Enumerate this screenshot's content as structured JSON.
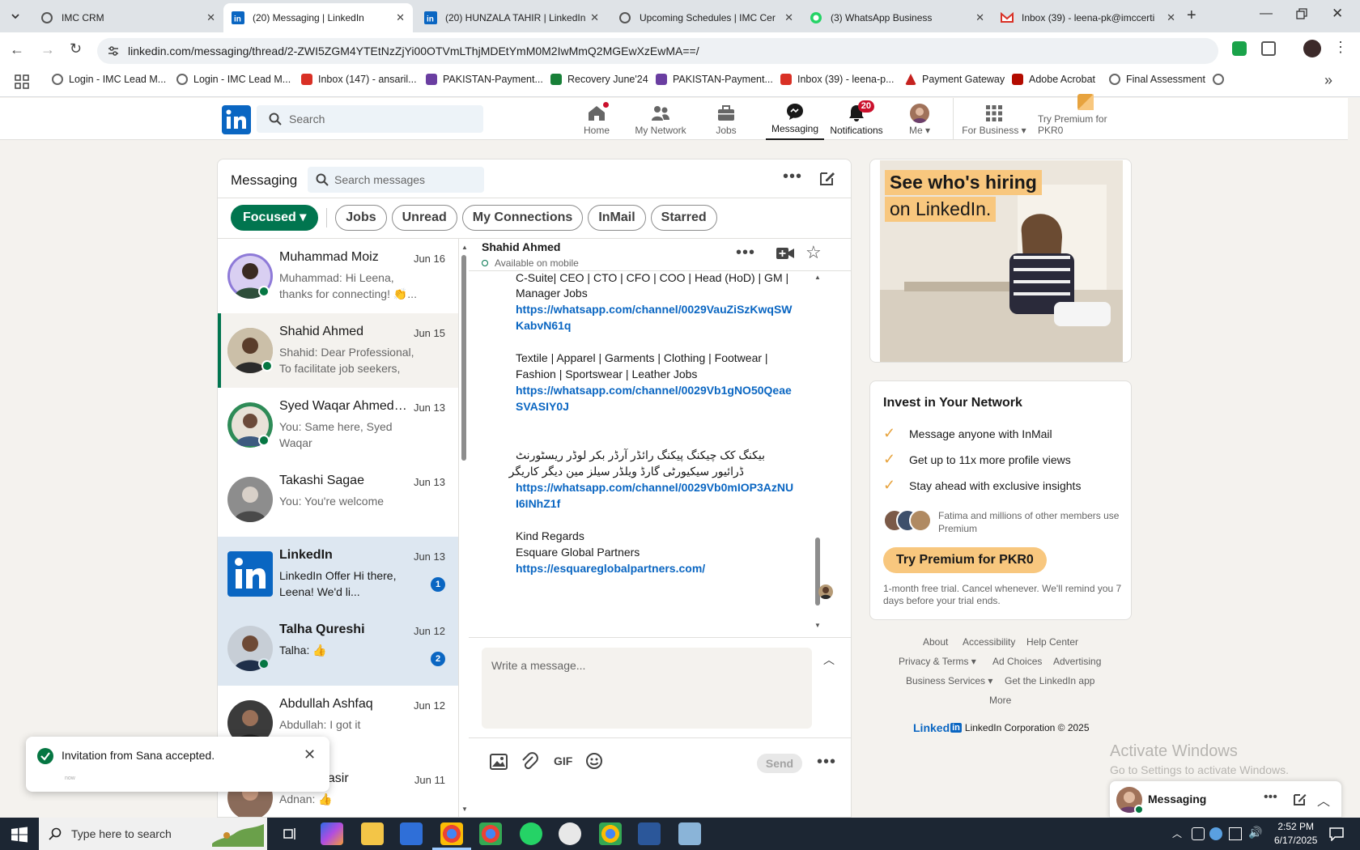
{
  "tabs": [
    {
      "title": "IMC CRM",
      "active": false
    },
    {
      "title": "(20) Messaging | LinkedIn",
      "active": true
    },
    {
      "title": "(20) HUNZALA TAHIR | LinkedIn",
      "active": false
    },
    {
      "title": "Upcoming Schedules | IMC Cer",
      "active": false
    },
    {
      "title": "(3) WhatsApp Business",
      "active": false
    },
    {
      "title": "Inbox (39) - leena-pk@imccerti",
      "active": false
    }
  ],
  "url": "linkedin.com/messaging/thread/2-ZWI5ZGM4YTEtNzZjYi00OTVmLThjMDEtYmM0M2IwMmQ2MGEwXzEwMA==/",
  "bookmarks": [
    "Login - IMC Lead M...",
    "Login - IMC Lead M...",
    "Inbox (147) - ansaril...",
    "PAKISTAN-Payment...",
    "Recovery June'24",
    "PAKISTAN-Payment...",
    "Inbox (39) - leena-p...",
    "Payment Gateway",
    "Adobe Acrobat",
    "Final Assessment"
  ],
  "nav": {
    "search_placeholder": "Search",
    "home": "Home",
    "network": "My Network",
    "jobs": "Jobs",
    "messaging": "Messaging",
    "notifications": "Notifications",
    "notifications_badge": "20",
    "me": "Me",
    "business": "For Business",
    "premium": "Try Premium for PKR0"
  },
  "messaging": {
    "title": "Messaging",
    "search_placeholder": "Search messages",
    "filters": [
      "Focused",
      "Jobs",
      "Unread",
      "My Connections",
      "InMail",
      "Starred"
    ]
  },
  "conversations": [
    {
      "name": "Muhammad Moiz",
      "date": "Jun 16",
      "preview": "Muhammad: Hi Leena, thanks for connecting! 👏...",
      "unread": false,
      "count": ""
    },
    {
      "name": "Shahid Ahmed",
      "date": "Jun 15",
      "preview": "Shahid: Dear Professional, To facilitate job seekers, Esquar...",
      "unread": false,
      "count": ""
    },
    {
      "name": "Syed Waqar Ahmed (...",
      "date": "Jun 13",
      "preview": "You: Same here, Syed Waqar",
      "unread": false,
      "count": ""
    },
    {
      "name": "Takashi Sagae",
      "date": "Jun 13",
      "preview": "You: You're welcome",
      "unread": false,
      "count": ""
    },
    {
      "name": "LinkedIn",
      "date": "Jun 13",
      "preview": "LinkedIn Offer  Hi there, Leena! We'd li...",
      "unread": true,
      "count": "1"
    },
    {
      "name": "Talha Qureshi",
      "date": "Jun 12",
      "preview": "Talha: 👍",
      "unread": true,
      "count": "2"
    },
    {
      "name": "Abdullah Ashfaq",
      "date": "Jun 12",
      "preview": "Abdullah: I got it",
      "unread": false,
      "count": ""
    },
    {
      "name": "Adnan Yasir",
      "date": "Jun 11",
      "preview": "Adnan: 👍",
      "unread": false,
      "count": ""
    }
  ],
  "thread": {
    "name": "Shahid Ahmed",
    "status": "Available on mobile",
    "lines": [
      "C-Suite| CEO | CTO | CFO | COO | Head (HoD) | GM | Sr",
      "Manager Jobs",
      "https://whatsapp.com/channel/0029VauZiSzKwqSW",
      "KabvN61q",
      "Textile | Apparel | Garments | Clothing | Footwear |",
      "Fashion | Sportswear | Leather Jobs",
      "https://whatsapp.com/channel/0029Vb1gNO50Qeae",
      "SVASIY0J",
      "بیکنگ کک چیکنگ پیکنگ رائڈر آرڈر بکر لوڈر ریسٹورنٹ",
      "ڈرائیور سیکیورٹی گارڈ ویلڈر سیلز مین دیگر کاریگر",
      "https://whatsapp.com/channel/0029Vb0mIOP3AzNU",
      "I6INhZ1f",
      "Kind Regards",
      "Esquare Global Partners",
      "https://esquareglobalpartners.com/"
    ],
    "compose_placeholder": "Write a message...",
    "gif": "GIF",
    "send": "Send"
  },
  "ad": {
    "line1": "See who's hiring",
    "line2": "on LinkedIn."
  },
  "premium_card": {
    "title": "Invest in Your Network",
    "benefits": [
      "Message anyone with InMail",
      "Get up to 11x more profile views",
      "Stay ahead with exclusive insights"
    ],
    "members": "Fatima and millions of other members use Premium",
    "button": "Try Premium for PKR0",
    "note": "1-month free trial. Cancel whenever. We'll remind you 7 days before your trial ends."
  },
  "footer": {
    "about": "About",
    "accessibility": "Accessibility",
    "help": "Help Center",
    "privacy": "Privacy & Terms",
    "adchoices": "Ad Choices",
    "advertising": "Advertising",
    "business": "Business Services",
    "app": "Get the LinkedIn app",
    "more": "More",
    "logo_word": "Linked",
    "copyright": "LinkedIn Corporation © 2025"
  },
  "toast": {
    "text": "Invitation from Sana accepted.",
    "sub": "now"
  },
  "watermark": {
    "line1": "Activate Windows",
    "line2": "Go to Settings to activate Windows."
  },
  "mini_messaging": "Messaging",
  "taskbar": {
    "search_placeholder": "Type here to search",
    "time": "2:52 PM",
    "date": "6/17/2025"
  },
  "colors": {
    "linkedin_blue": "#0a66c2",
    "green": "#01754f",
    "premium_gold": "#f8c77e"
  }
}
